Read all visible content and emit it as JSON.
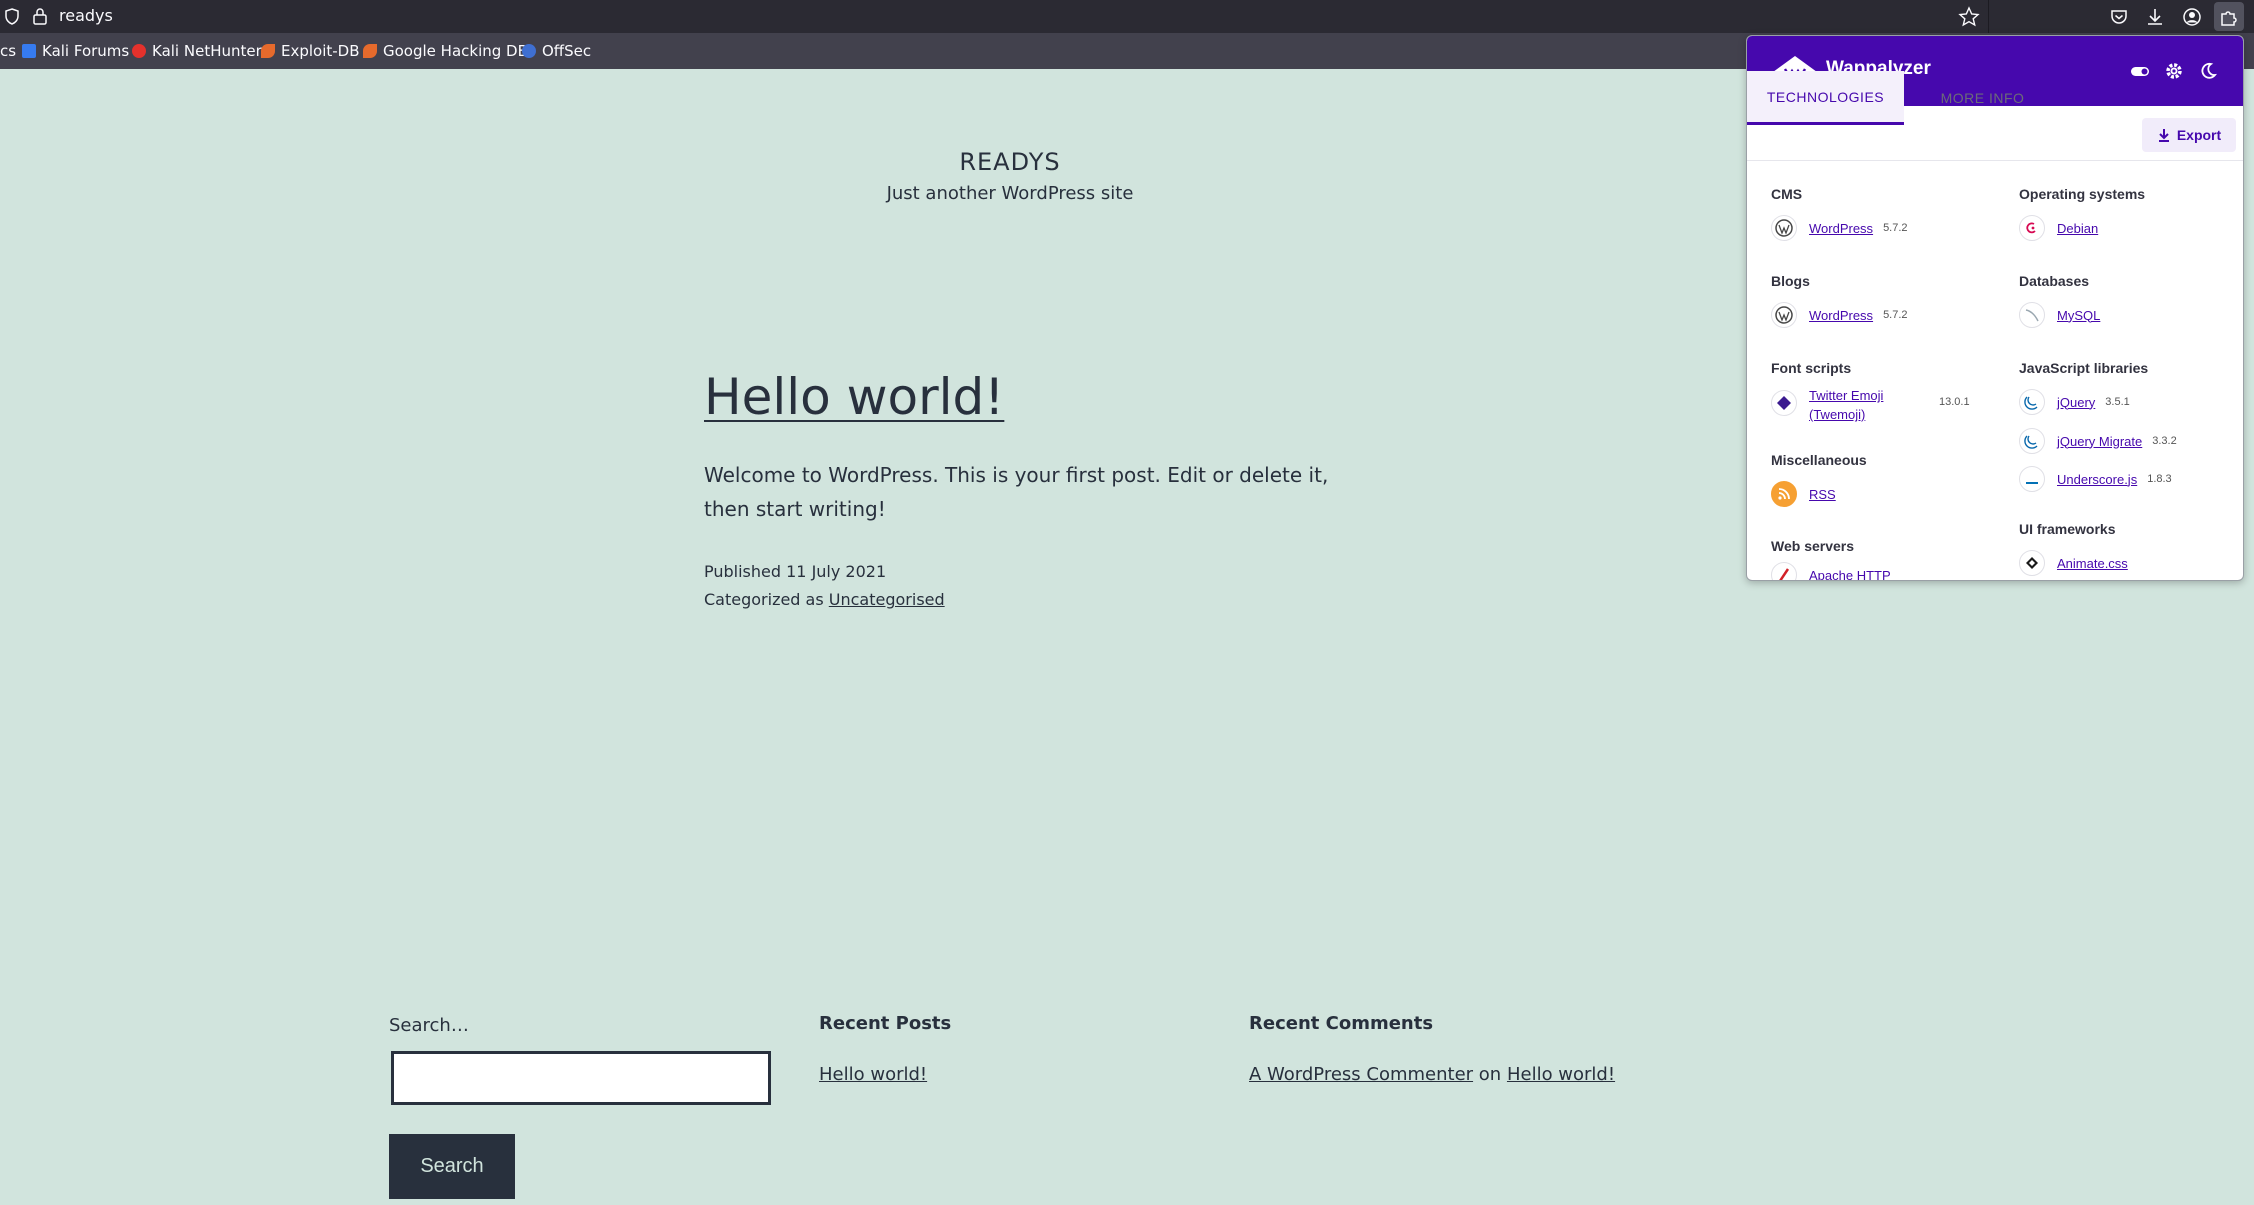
{
  "browser": {
    "url": "readys",
    "bookmarks": [
      {
        "label": "cs",
        "color": "#888888"
      },
      {
        "label": "Kali Forums",
        "color": "#367bf0"
      },
      {
        "label": "Kali NetHunter",
        "color": "#e5312c"
      },
      {
        "label": "Exploit-DB",
        "color": "#e66a2c"
      },
      {
        "label": "Google Hacking DB",
        "color": "#e66a2c"
      },
      {
        "label": "OffSec",
        "color": "#3f6fd1"
      }
    ]
  },
  "site": {
    "title": "READYS",
    "description": "Just another WordPress site"
  },
  "post": {
    "title": "Hello world!",
    "body": "Welcome to WordPress. This is your first post. Edit or delete it, then start writing!",
    "published_label": "Published",
    "published_date": "11 July 2021",
    "categorized_label": "Categorized as",
    "category": "Uncategorised"
  },
  "footer": {
    "search_label": "Search…",
    "search_value": "",
    "search_button": "Search",
    "recent_posts_title": "Recent Posts",
    "recent_post_link": "Hello world!",
    "recent_comments_title": "Recent Comments",
    "comment_author": "A WordPress Commenter",
    "comment_on": "on",
    "comment_post": "Hello world!"
  },
  "wappalyzer": {
    "brand": "Wappalyzer",
    "accent_color": "#4608ad",
    "tabs": [
      "TECHNOLOGIES",
      "MORE INFO"
    ],
    "export_label": "Export",
    "categories": {
      "cms": {
        "name": "CMS",
        "tech": [
          {
            "name": "WordPress",
            "version": "5.7.2",
            "icon": "wordpress-icon"
          }
        ]
      },
      "blogs": {
        "name": "Blogs",
        "tech": [
          {
            "name": "WordPress",
            "version": "5.7.2",
            "icon": "wordpress-icon"
          }
        ]
      },
      "font_scripts": {
        "name": "Font scripts",
        "tech": [
          {
            "name": "Twitter Emoji (Twemoji)",
            "name_line1": "Twitter Emoji",
            "name_line2": "(Twemoji)",
            "version": "13.0.1",
            "icon": "twemoji-icon"
          }
        ]
      },
      "misc": {
        "name": "Miscellaneous",
        "tech": [
          {
            "name": "RSS",
            "version": "",
            "icon": "rss-icon"
          }
        ]
      },
      "web_servers": {
        "name": "Web servers",
        "tech": [
          {
            "name": "Apache HTTP",
            "version": "",
            "icon": "apache-icon"
          }
        ]
      },
      "os": {
        "name": "Operating systems",
        "tech": [
          {
            "name": "Debian",
            "version": "",
            "icon": "debian-icon"
          }
        ]
      },
      "databases": {
        "name": "Databases",
        "tech": [
          {
            "name": "MySQL",
            "version": "",
            "icon": "mysql-icon"
          }
        ]
      },
      "js_libs": {
        "name": "JavaScript libraries",
        "tech": [
          {
            "name": "jQuery",
            "version": "3.5.1",
            "icon": "jquery-icon"
          },
          {
            "name": "jQuery Migrate",
            "version": "3.3.2",
            "icon": "jquery-icon"
          },
          {
            "name": "Underscore.js",
            "version": "1.8.3",
            "icon": "underscore-icon"
          }
        ]
      },
      "ui_frameworks": {
        "name": "UI frameworks",
        "tech": [
          {
            "name": "Animate.css",
            "version": "",
            "icon": "animate-css-icon"
          }
        ]
      }
    }
  }
}
